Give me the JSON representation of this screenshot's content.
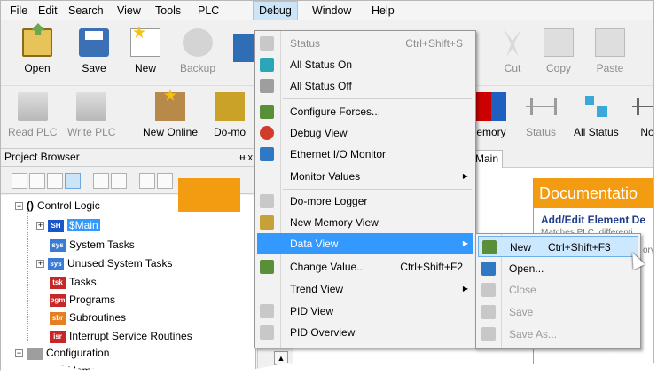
{
  "menubar": {
    "items": [
      "File",
      "Edit",
      "Search",
      "View",
      "Tools",
      "PLC",
      "Debug",
      "Window",
      "Help"
    ],
    "active": "Debug"
  },
  "toolbar1": {
    "open": "Open",
    "save": "Save",
    "new": "New",
    "backup": "Backup",
    "cut": "Cut",
    "copy": "Copy",
    "paste": "Paste"
  },
  "toolbar2": {
    "read_plc": "Read PLC",
    "write_plc": "Write PLC",
    "new_online": "New Online",
    "domore": "Do-mo",
    "memory": "emory",
    "status": "Status",
    "all_status": "All Status",
    "no": "No"
  },
  "project_browser": {
    "title": "Project Browser",
    "pin": "ᵾ x",
    "tree": [
      {
        "label": "Control Logic",
        "icon": "()"
      },
      {
        "label": "$Main",
        "icon": "SH"
      },
      {
        "label": "System Tasks",
        "icon": "sys"
      },
      {
        "label": "Unused System Tasks",
        "icon": "sys"
      },
      {
        "label": "Tasks",
        "icon": "tsk"
      },
      {
        "label": "Programs",
        "icon": "pgm"
      },
      {
        "label": "Subroutines",
        "icon": "sbr"
      },
      {
        "label": "Interrupt Service Routines",
        "icon": "isr"
      },
      {
        "label": "Configuration",
        "icon": ""
      },
      {
        "label": "Memory",
        "icon": ""
      }
    ]
  },
  "tabs": {
    "main": "Main"
  },
  "documentation": {
    "title": "Documentatio",
    "link": "Add/Edit Element De",
    "sub": "Matches PLC, differenti",
    "side": "ory"
  },
  "debug_menu": {
    "items": [
      {
        "label": "Status",
        "shortcut": "Ctrl+Shift+S",
        "disabled": true
      },
      {
        "label": "All Status On"
      },
      {
        "label": "All Status Off"
      },
      {
        "label": "Configure Forces..."
      },
      {
        "label": "Debug View"
      },
      {
        "label": "Ethernet I/O Monitor"
      },
      {
        "label": "Monitor Values",
        "submenu": true
      },
      {
        "label": "Do-more Logger"
      },
      {
        "label": "New Memory View"
      },
      {
        "label": "Data View",
        "submenu": true,
        "highlighted": true
      },
      {
        "label": "Change Value...",
        "shortcut": "Ctrl+Shift+F2"
      },
      {
        "label": "Trend View",
        "submenu": true
      },
      {
        "label": "PID View"
      },
      {
        "label": "PID Overview"
      }
    ]
  },
  "data_view_submenu": {
    "items": [
      {
        "label": "New",
        "shortcut": "Ctrl+Shift+F3",
        "highlighted": true
      },
      {
        "label": "Open..."
      },
      {
        "label": "Close",
        "disabled": true
      },
      {
        "label": "Save",
        "disabled": true
      },
      {
        "label": "Save As...",
        "disabled": true
      }
    ]
  },
  "colors": {
    "menu_highlight": "#3399ff",
    "submenu_highlight": "#cce8ff",
    "orange": "#f39c12"
  }
}
